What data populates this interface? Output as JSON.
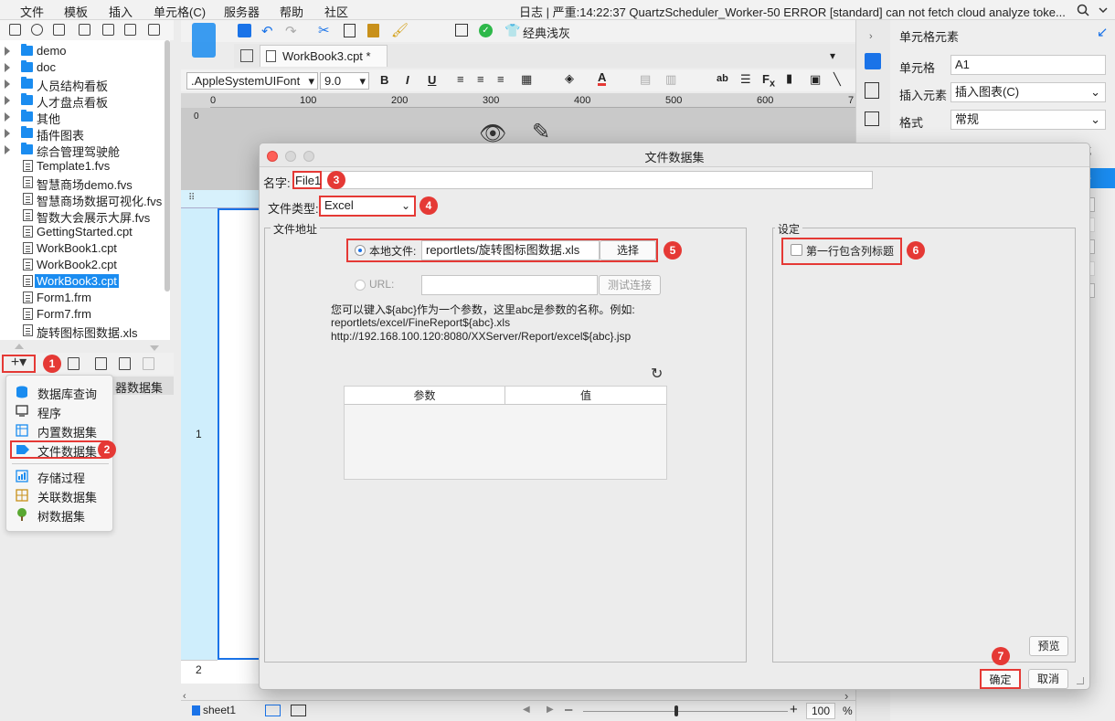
{
  "menubar": {
    "items": [
      "文件",
      "模板",
      "插入",
      "单元格(C)",
      "服务器",
      "帮助",
      "社区"
    ],
    "status": "日志 | 严重:14:22:37 QuartzScheduler_Worker-50 ERROR [standard] can not fetch cloud analyze toke..."
  },
  "file_tree": {
    "items": [
      {
        "label": "demo",
        "type": "folder"
      },
      {
        "label": "doc",
        "type": "folder"
      },
      {
        "label": "人员结构看板",
        "type": "folder"
      },
      {
        "label": "人才盘点看板",
        "type": "folder"
      },
      {
        "label": "其他",
        "type": "folder"
      },
      {
        "label": "插件图表",
        "type": "folder"
      },
      {
        "label": "综合管理驾驶舱",
        "type": "folder"
      },
      {
        "label": "Template1.fvs",
        "type": "file"
      },
      {
        "label": "智慧商场demo.fvs",
        "type": "file"
      },
      {
        "label": "智慧商场数据可视化.fvs",
        "type": "file"
      },
      {
        "label": "智数大会展示大屏.fvs",
        "type": "file"
      },
      {
        "label": "GettingStarted.cpt",
        "type": "file"
      },
      {
        "label": "WorkBook1.cpt",
        "type": "file"
      },
      {
        "label": "WorkBook2.cpt",
        "type": "file"
      },
      {
        "label": "WorkBook3.cpt",
        "type": "file",
        "selected": true
      },
      {
        "label": "Form1.frm",
        "type": "file"
      },
      {
        "label": "Form7.frm",
        "type": "file"
      },
      {
        "label": "旋转图标图数据.xls",
        "type": "file"
      }
    ]
  },
  "datasource_panel": {
    "add_label": "+▾",
    "header_partial": "器数据集",
    "menu_items": [
      {
        "label": "数据库查询",
        "icon": "database-icon"
      },
      {
        "label": "程序",
        "icon": "program-icon"
      },
      {
        "label": "内置数据集",
        "icon": "embedded-dataset-icon"
      },
      {
        "label": "文件数据集",
        "icon": "file-dataset-icon",
        "highlight": true
      },
      {
        "label": "存储过程",
        "icon": "stored-procedure-icon"
      },
      {
        "label": "关联数据集",
        "icon": "joined-dataset-icon"
      },
      {
        "label": "树数据集",
        "icon": "tree-dataset-icon"
      }
    ]
  },
  "editor": {
    "tab_title": "WorkBook3.cpt *",
    "theme_label": "经典浅灰",
    "font_name": ".AppleSystemUIFont",
    "font_size": "9.0",
    "ruler_ticks": [
      "0",
      "100",
      "200",
      "300",
      "400",
      "500",
      "600",
      "7"
    ],
    "row_numbers": [
      "1",
      "2"
    ],
    "sheet_tab": "sheet1",
    "zoom": "100",
    "zoom_unit": "%",
    "ruler_v": "0"
  },
  "right_panel": {
    "title": "单元格元素",
    "cell_label": "单元格",
    "cell_value": "A1",
    "insert_label": "插入元素",
    "insert_value": "插入图表(C)",
    "format_label": "格式",
    "format_value": "常规",
    "partial_tab": "式",
    "partial_tab2": "转"
  },
  "dialog": {
    "title": "文件数据集",
    "name_label": "名字:",
    "name_value": "File1",
    "type_label": "文件类型:",
    "type_value": "Excel",
    "address_group": "文件地址",
    "local_label": "本地文件:",
    "local_path": "reportlets/旋转图标图数据.xls",
    "choose_button": "选择",
    "url_label": "URL:",
    "url_value": "",
    "test_button": "测试连接",
    "hint_lines": [
      "您可以键入${abc}作为一个参数，这里abc是参数的名称。例如:",
      "reportlets/excel/FineReport${abc}.xls",
      "http://192.168.100.120:8080/XXServer/Report/excel${abc}.jsp"
    ],
    "param_col": "参数",
    "value_col": "值",
    "settings_group": "设定",
    "first_row_label": "第一行包含列标题",
    "preview_button": "预览",
    "ok_button": "确定",
    "cancel_button": "取消"
  },
  "badges": [
    "1",
    "2",
    "3",
    "4",
    "5",
    "6",
    "7"
  ],
  "colors": {
    "accent": "#1a8cf0",
    "badge_red": "#e53935",
    "selection_blue": "#1a73e8"
  }
}
